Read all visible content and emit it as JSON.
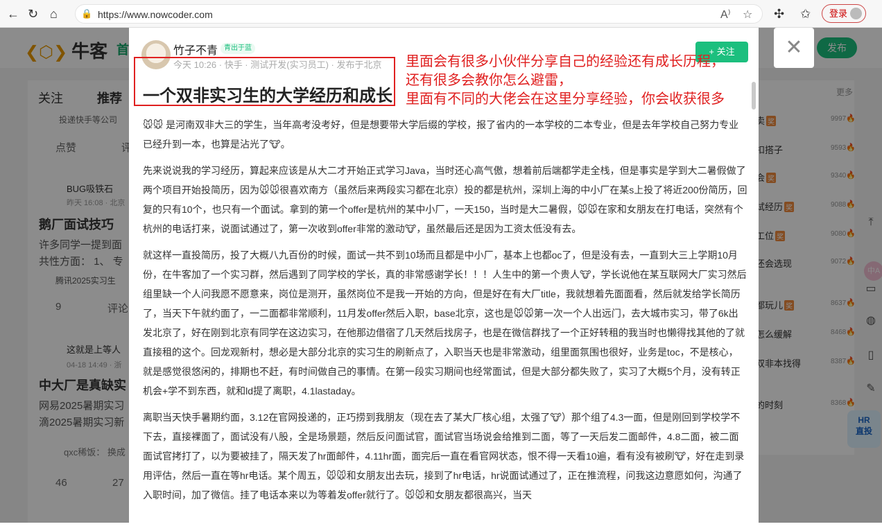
{
  "browser": {
    "url": "https://www.nowcoder.com",
    "login_label": "登录"
  },
  "background": {
    "logo": "牛客",
    "nav_home": "首",
    "publish": "发布",
    "tabs": [
      "关注",
      "推荐"
    ],
    "more": "更多",
    "feed": [
      {
        "company": "投递快手等公司",
        "like_label": "点赞",
        "comment_label": "评"
      },
      {
        "author": "BUG吸铁石",
        "time": "昨天 16:08 · 北京",
        "title": "鹅厂面试技巧",
        "text1": "许多同学一提到面",
        "text2": "共性方面：  1、  专",
        "tag": "腾讯2025实习生",
        "likes": "9",
        "comment_label": "评论"
      },
      {
        "author": "这就是上等人",
        "time": "04-18 14:49 · 浙",
        "title": "中大厂是真缺实",
        "text1": "网易2025暑期实习",
        "text2": "滴2025暑期实习新",
        "reply": "qxc稀饭：  换成",
        "likes": "46",
        "comments": "27"
      }
    ],
    "hot_list": [
      {
        "text": "卖",
        "count": "9997",
        "tag": "奖"
      },
      {
        "text": "扣搭子",
        "count": "9593",
        "tag": ""
      },
      {
        "text": "会",
        "count": "9340",
        "tag": "奖"
      },
      {
        "text": "试经历",
        "count": "9088",
        "tag": "奖"
      },
      {
        "text": "工位",
        "count": "9080",
        "tag": "奖"
      },
      {
        "text": "还会选现",
        "count": "9072",
        "tag": ""
      },
      {
        "text": "都玩儿",
        "count": "8637",
        "tag": "奖"
      },
      {
        "text": "怎么缓解",
        "count": "8468",
        "tag": ""
      },
      {
        "text": "双非本找得",
        "count": "8387",
        "tag": ""
      },
      {
        "text": "的时刻",
        "count": "8368",
        "tag": ""
      }
    ],
    "hr_badge": [
      "HR",
      "直投"
    ],
    "voice_label": "中A"
  },
  "post": {
    "author": "竹子不青",
    "author_badge": "青出于蓝",
    "meta": "今天 10:26 · 快手 · 测试开发(实习员工)  · 发布于北京",
    "follow_label": "+ 关注",
    "title": "一个双非实习生的大学经历和成长",
    "annotation": [
      "里面会有很多小伙伴分享自己的经验还有成长历程，",
      "还有很多会教你怎么避雷，",
      "里面有不同的大佬会在这里分享经验，你会收获很多"
    ],
    "paragraphs": [
      "🐭🐭 是河南双非大三的学生，当年高考没考好，但是想要带大学后缀的学校，报了省内的一本学校的二本专业，但是去年学校自己努力专业已经升到一本，也算是沾光了🐮。",
      "先来说说我的学习经历，算起来应该是从大二才开始正式学习Java，当时还心高气傲，想着前后端都学走全栈，但是事实是学到大二暑假做了两个项目开始投简历，因为🐭🐭很喜欢南方（虽然后来两段实习都在北京）投的都是杭州，深圳上海的中小厂在某s上投了将近200份简历，回复的只有10个，也只有一个面试。拿到的第一个offer是杭州的某中小厂，一天150，当时是大二暑假，🐭🐭在家和女朋友在打电话，突然有个杭州的电话打来，说面试通过了，第一次收到offer非常的激动🐮，虽然最后还是因为工资太低没有去。",
      "就这样一直投简历，投了大概八九百份的时候，面试一共不到10场而且都是中小厂，基本上也都oc了，但是没有去，一直到大三上学期10月份，在牛客加了一个实习群，然后遇到了同学校的学长，真的非常感谢学长！！！人生中的第一个贵人🐮，学长说他在某互联网大厂实习然后组里缺一个人问我愿不愿意来，岗位是测开，虽然岗位不是我一开始的方向，但是好在有大厂title，我就想着先面面看，然后就发给学长简历了，当天下午就约面了，一二面都非常顺利，11月发offer然后入职，base北京，这也是🐭🐭第一次一个人出远门，去大城市实习，带了6k出发北京了，好在刚到北京有同学在这边实习，在他那边借宿了几天然后找房子，也是在微信群找了一个正好转租的我当时也懒得找其他的了就直接租的这个。回龙观新村，想必是大部分北京的实习生的刷新点了，入职当天也是非常激动，组里面氛围也很好，业务是toc，不是核心，就是感觉很悠闲的，排期也不赶，有时间做自己的事情。在第一段实习期间也经常面试，但是大部分都失败了，实习了大概5个月，没有转正机会+学不到东西，就和ld提了离职，4.1lastaday。",
      "离职当天快手暑期约面，3.12在官网投递的，正巧捞到我朋友（现在去了某大厂核心组，太强了🐮）那个组了4.3一面，但是刚回到学校学不下去，直接裸面了，面试没有八股，全是场景题，然后反问面试官，面试官当场说会给推到二面，等了一天后发二面邮件，4.8二面，被二面面试官拷打了，以为要被挂了，隔天发了hr面邮件，4.11hr面，面完后一直在看官网状态，恨不得一天看10遍，看有没有被刷🐮，好在走到录用评估，然后一直在等hr电话。某个周五，🐭🐭和女朋友出去玩，接到了hr电话，hr说面试通过了，正在推流程，问我这边意愿如何，沟通了入职时间，加了微信。挂了电话本来以为等着发offer就行了。🐭🐭和女朋友都很高兴，当天"
    ]
  }
}
